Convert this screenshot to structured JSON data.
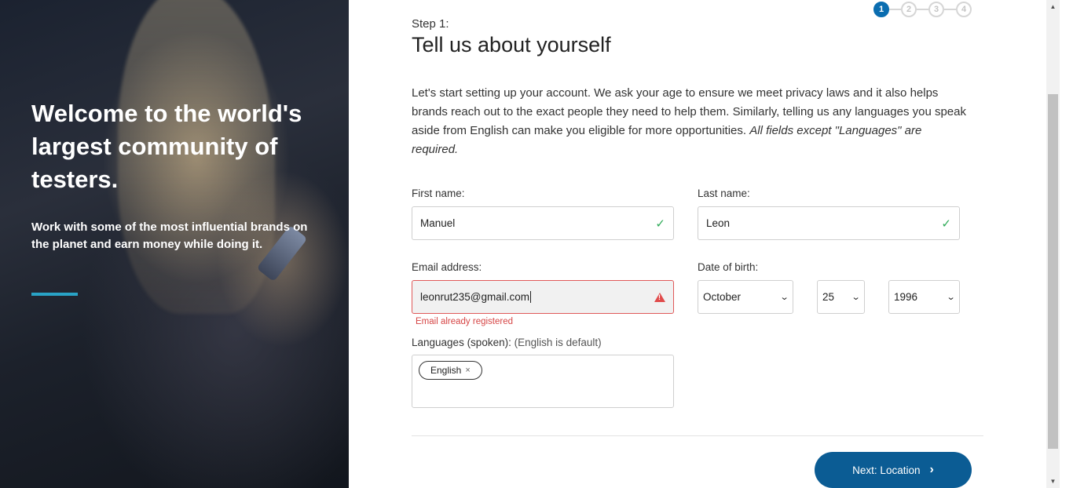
{
  "hero": {
    "title": "Welcome to the world's largest community of testers.",
    "subtitle": "Work with some of the most influential brands on the planet and earn money while doing it.",
    "accent_color": "#29a3c6"
  },
  "steps": {
    "items": [
      "1",
      "2",
      "3",
      "4"
    ],
    "current": 1
  },
  "step_label": "Step 1:",
  "page_title": "Tell us about yourself",
  "intro": {
    "text": "Let's start setting up your account. We ask your age to ensure we meet privacy laws and it also helps brands reach out to the exact people they need to help them. Similarly, telling us any languages you speak aside from English can make you eligible for more opportunities.",
    "emphasis": "All fields except \"Languages\" are required."
  },
  "form": {
    "first_name": {
      "label": "First name:",
      "value": "Manuel",
      "status": "valid"
    },
    "last_name": {
      "label": "Last name:",
      "value": "Leon",
      "status": "valid"
    },
    "email": {
      "label": "Email address:",
      "value": "leonrut235@gmail.com",
      "status": "error",
      "error": "Email already registered"
    },
    "dob": {
      "label": "Date of birth:",
      "month": "October",
      "day": "25",
      "year": "1996"
    },
    "languages": {
      "label": "Languages (spoken):",
      "hint": "(English is default)",
      "chips": [
        "English"
      ]
    }
  },
  "next_button": {
    "label": "Next: Location",
    "color": "#0b5c94"
  },
  "icons": {
    "valid": "✓",
    "warning": "warning-triangle",
    "chevron": "⌄",
    "chip_remove": "×",
    "next_arrow": "›"
  }
}
